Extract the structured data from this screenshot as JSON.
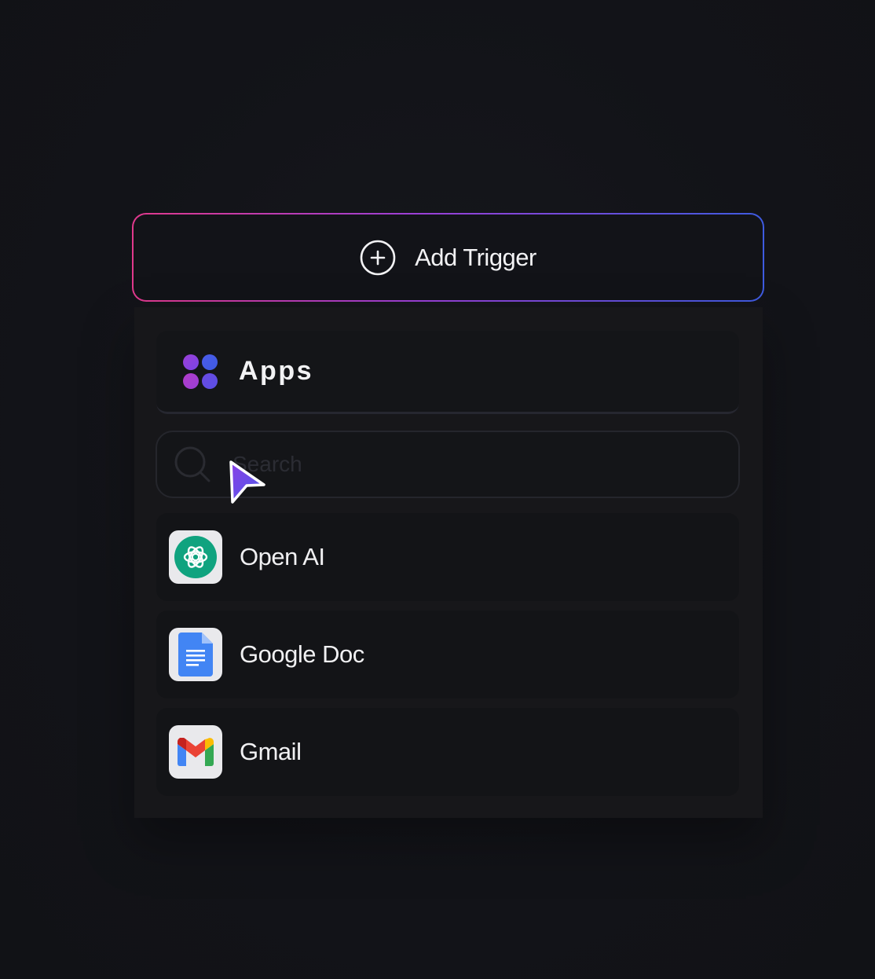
{
  "trigger": {
    "label": "Add Trigger",
    "icon": "plus-circle-icon",
    "border_colors": [
      "#E0398C",
      "#9B3FD6",
      "#3E5BE0"
    ]
  },
  "apps_panel": {
    "title": "Apps",
    "icon": "apps-grid-icon",
    "icon_colors": [
      "#8A3FE0",
      "#3E5BE0",
      "#B03CC8",
      "#6A4AE0"
    ]
  },
  "search": {
    "placeholder": "Search",
    "value": ""
  },
  "apps": [
    {
      "label": "Open AI",
      "icon": "openai-icon",
      "color": "#10A37F"
    },
    {
      "label": "Google Doc",
      "icon": "google-docs-icon",
      "color": "#4285F4"
    },
    {
      "label": "Gmail",
      "icon": "gmail-icon",
      "color": "#EA4335"
    }
  ],
  "cursor": {
    "icon": "pointer-cursor-icon",
    "colors": [
      "#7A3FE6",
      "#4B5BEA"
    ]
  }
}
